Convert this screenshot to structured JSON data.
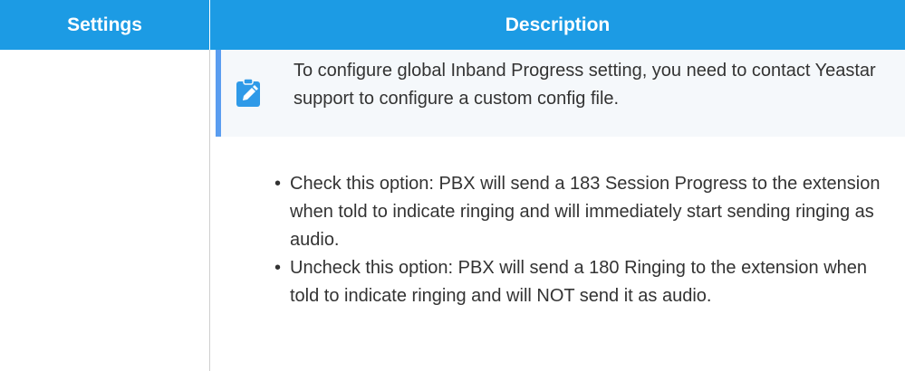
{
  "table": {
    "headers": {
      "settings": "Settings",
      "description": "Description"
    },
    "note": {
      "icon": "edit-pencil-icon",
      "accent_color": "#5a9df0",
      "text": "To configure global Inband Progress setting, you need to contact Yeastar support to configure a custom config file."
    },
    "bullets": [
      {
        "marker": "•",
        "text": "Check this option: PBX will send a 183 Session Progress to the extension when told to indicate ringing and will immediately start sending ringing as audio."
      },
      {
        "marker": "•",
        "text": "Uncheck this option: PBX will send a 180 Ringing to the extension when told to indicate ringing and will NOT send it as audio."
      }
    ]
  },
  "colors": {
    "header_background": "#1c9be4",
    "header_text": "#ffffff"
  }
}
